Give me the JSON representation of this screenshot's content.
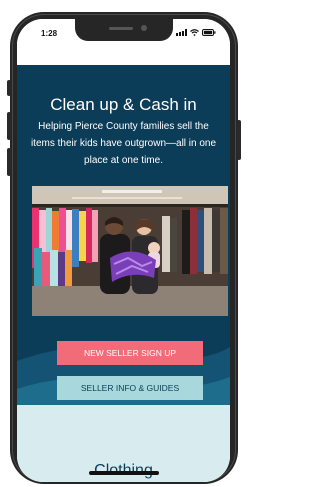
{
  "status_bar": {
    "time": "1:28"
  },
  "hero": {
    "headline": "Clean up & Cash in",
    "subtext": "Helping Pierce County families sell the items their kids have outgrown—all in one place at one time."
  },
  "buttons": {
    "signup_label": "NEW SELLER SIGN UP",
    "info_label": "SELLER INFO & GUIDES"
  },
  "lower_section": {
    "cut_heading": "Clothing"
  },
  "colors": {
    "hero_bg": "#0c3d58",
    "signup_bg": "#f26b78",
    "info_bg": "#a8d8dc",
    "lower_bg": "#d8ecef"
  },
  "icons": [
    "signal-icon",
    "wifi-icon",
    "battery-icon"
  ]
}
